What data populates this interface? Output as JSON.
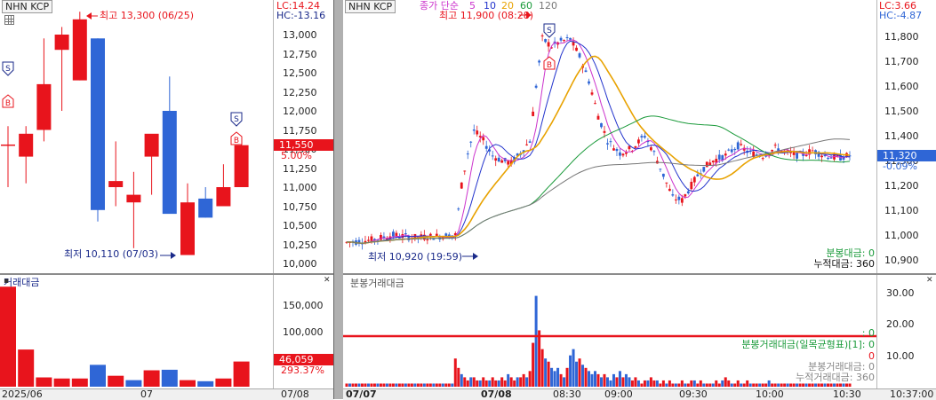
{
  "left": {
    "stock_label": "NHN KCP",
    "lc": "LC:14.24",
    "hc": "HC:-13.16",
    "high_note": "최고 13,300 (06/25)",
    "low_note": "최저 10,110 (07/03)",
    "price_ticks": [
      "13,000",
      "12,750",
      "12,500",
      "12,250",
      "12,000",
      "11,750",
      "11,500",
      "11,250",
      "11,000",
      "10,750",
      "10,500",
      "10,250",
      "10,000"
    ],
    "current_price": "11,550",
    "current_pct": "5.00%",
    "volume_title": "거래대금",
    "volume_ticks": [
      "150,000",
      "100,000",
      "50,000"
    ],
    "volume_value": "46,059",
    "volume_pct": "293.37%",
    "x_labels": [
      "2025/06",
      "07"
    ],
    "x_right_label": "07/08",
    "signal_s": "S",
    "signal_b": "B"
  },
  "right": {
    "stock_label": "NHN KCP",
    "ma_label": "종가 단순",
    "ma_periods": [
      "5",
      "10",
      "20",
      "60",
      "120"
    ],
    "lc": "LC:3.66",
    "hc": "HC:-4.87",
    "high_note": "최고 11,900 (08:28)",
    "low_note": "최저 10,920 (19:59)",
    "price_ticks": [
      "11,800",
      "11,700",
      "11,600",
      "11,500",
      "11,400",
      "11,300",
      "11,200",
      "11,100",
      "11,000",
      "10,900"
    ],
    "current_price": "11,320",
    "current_pct": "-0.09%",
    "info1": "분봉대금: 0",
    "info2": "누적대금: 360",
    "volume_title": "분봉거래대금",
    "volume_ticks": [
      "30.00",
      "20.00",
      "10.00"
    ],
    "vol_legend": "분봉거래대금(일목균형표)[1]: 0",
    "vol_colon": ": 0",
    "vol_zero": "0",
    "vol_info1": "분봉거래대금: 0",
    "vol_info2": "누적거래대금: 360",
    "x_labels": [
      "07/07",
      "07/08",
      "08:30",
      "09:00",
      "09:30",
      "10:00",
      "10:30"
    ],
    "x_right_label": "10:37:00",
    "signal_s": "S",
    "signal_b": "B"
  },
  "colors": {
    "up": "#e8141c",
    "down": "#2f66d6",
    "ma5": "#cc33cc",
    "ma10": "#2233cc",
    "ma20": "#e8a200",
    "ma60": "#1a9a3a",
    "ma120": "#777777",
    "label_bg": "#e8141c",
    "navy": "#1a2a8a"
  },
  "chart_data": [
    {
      "type": "candlestick",
      "title": "NHN KCP",
      "x_labels": [
        "2025/06",
        "07"
      ],
      "ylim": [
        10000,
        13000
      ],
      "candles": [
        {
          "o": 11550,
          "h": 11800,
          "l": 11000,
          "c": 11550,
          "dir": "flat"
        },
        {
          "o": 11400,
          "h": 11800,
          "l": 11050,
          "c": 11700,
          "dir": "up"
        },
        {
          "o": 11750,
          "h": 12950,
          "l": 11600,
          "c": 12350,
          "dir": "up"
        },
        {
          "o": 12800,
          "h": 13100,
          "l": 12000,
          "c": 13000,
          "dir": "up"
        },
        {
          "o": 12400,
          "h": 13300,
          "l": 12400,
          "c": 13200,
          "dir": "up"
        },
        {
          "o": 12950,
          "h": 12950,
          "l": 10550,
          "c": 10700,
          "dir": "down"
        },
        {
          "o": 11080,
          "h": 11600,
          "l": 10750,
          "c": 11000,
          "dir": "up"
        },
        {
          "o": 10800,
          "h": 11200,
          "l": 10200,
          "c": 10900,
          "dir": "up"
        },
        {
          "o": 11400,
          "h": 11550,
          "l": 10900,
          "c": 11700,
          "dir": "up"
        },
        {
          "o": 12000,
          "h": 12450,
          "l": 10750,
          "c": 10650,
          "dir": "down"
        },
        {
          "o": 10110,
          "h": 11050,
          "l": 10110,
          "c": 10800,
          "dir": "up"
        },
        {
          "o": 10850,
          "h": 11000,
          "l": 10600,
          "c": 10600,
          "dir": "down"
        },
        {
          "o": 10750,
          "h": 11300,
          "l": 10750,
          "c": 11000,
          "dir": "up"
        },
        {
          "o": 11000,
          "h": 11650,
          "l": 11000,
          "c": 11550,
          "dir": "up"
        }
      ],
      "volume": {
        "title": "거래대금",
        "ylim": [
          0,
          185000
        ],
        "values": [
          183000,
          68000,
          17000,
          15000,
          15000,
          40000,
          20000,
          12000,
          30000,
          31000,
          12000,
          10000,
          15000,
          46059
        ],
        "dirs": [
          "up",
          "up",
          "up",
          "up",
          "up",
          "down",
          "up",
          "down",
          "up",
          "down",
          "up",
          "down",
          "up",
          "up"
        ]
      }
    },
    {
      "type": "candlestick",
      "title": "NHN KCP",
      "x_labels": [
        "07/07",
        "07/08",
        "08:30",
        "09:00",
        "09:30",
        "10:00",
        "10:30"
      ],
      "ylim": [
        10900,
        11850
      ],
      "moving_averages": [
        "5",
        "10",
        "20",
        "60",
        "120"
      ],
      "price_path": [
        [
          0,
          10970
        ],
        [
          8,
          10980
        ],
        [
          15,
          11000
        ],
        [
          22,
          10990
        ],
        [
          29,
          10995
        ],
        [
          35,
          11000
        ],
        [
          37,
          11200
        ],
        [
          39,
          11330
        ],
        [
          41,
          11420
        ],
        [
          44,
          11380
        ],
        [
          47,
          11320
        ],
        [
          50,
          11300
        ],
        [
          53,
          11290
        ],
        [
          56,
          11330
        ],
        [
          59,
          11380
        ],
        [
          61,
          11600
        ],
        [
          63,
          11790
        ],
        [
          66,
          11760
        ],
        [
          69,
          11780
        ],
        [
          72,
          11790
        ],
        [
          75,
          11720
        ],
        [
          78,
          11620
        ],
        [
          81,
          11480
        ],
        [
          84,
          11380
        ],
        [
          88,
          11330
        ],
        [
          92,
          11350
        ],
        [
          96,
          11400
        ],
        [
          99,
          11330
        ],
        [
          102,
          11240
        ],
        [
          105,
          11150
        ],
        [
          108,
          11140
        ],
        [
          111,
          11200
        ],
        [
          114,
          11260
        ],
        [
          118,
          11300
        ],
        [
          122,
          11320
        ],
        [
          126,
          11360
        ],
        [
          130,
          11330
        ],
        [
          134,
          11320
        ],
        [
          138,
          11350
        ],
        [
          142,
          11330
        ],
        [
          146,
          11320
        ],
        [
          150,
          11340
        ],
        [
          154,
          11320
        ],
        [
          158,
          11310
        ],
        [
          162,
          11320
        ]
      ],
      "volume": {
        "title": "분봉거래대금",
        "ylim": [
          0,
          32
        ],
        "peak_index": 61,
        "values": [
          1,
          1,
          1,
          1,
          1,
          1,
          1,
          1,
          1,
          1,
          1,
          1,
          1,
          1,
          1,
          1,
          1,
          1,
          1,
          1,
          1,
          1,
          1,
          1,
          1,
          1,
          1,
          1,
          1,
          1,
          1,
          1,
          1,
          1,
          1,
          9,
          6,
          4,
          3,
          2,
          3,
          3,
          2,
          2,
          3,
          2,
          2,
          3,
          2,
          2,
          3,
          2,
          4,
          3,
          2,
          3,
          3,
          4,
          3,
          5,
          14,
          29,
          18,
          12,
          9,
          8,
          6,
          5,
          6,
          4,
          3,
          6,
          10,
          12,
          8,
          9,
          7,
          6,
          5,
          4,
          5,
          4,
          3,
          4,
          3,
          2,
          4,
          3,
          5,
          3,
          4,
          3,
          2,
          3,
          2,
          1,
          2,
          2,
          3,
          2,
          2,
          1,
          2,
          1,
          2,
          1,
          1,
          1,
          2,
          1,
          1,
          2,
          2,
          1,
          2,
          1,
          1,
          1,
          1,
          2,
          1,
          2,
          3,
          2,
          1,
          1,
          2,
          1,
          1,
          2,
          1,
          1,
          1,
          1,
          1,
          1,
          2,
          1,
          1,
          1,
          1,
          1,
          1,
          1,
          1,
          1,
          1,
          1,
          1,
          1,
          1,
          1,
          1,
          1,
          1,
          1,
          1,
          1,
          1,
          1,
          1,
          1,
          1
        ]
      }
    }
  ]
}
